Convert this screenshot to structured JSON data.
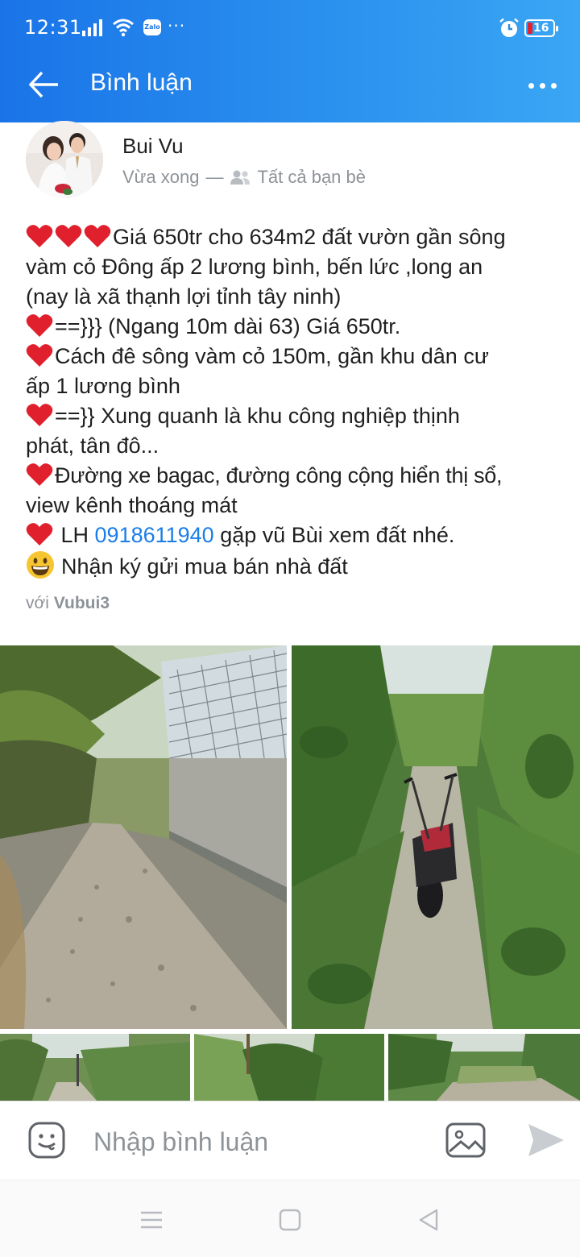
{
  "status_bar": {
    "time": "12:31",
    "app_badge": "Zalo",
    "more": "···",
    "battery_level": "16"
  },
  "header": {
    "title": "Bình luận"
  },
  "post": {
    "author": "Bui Vu",
    "time": "Vừa xong",
    "separator": "—",
    "privacy": "Tất cả bạn bè",
    "lines": {
      "l1": "Giá 650tr cho 634m2 đất vườn gần sông",
      "l2": "vàm cỏ Đông ấp 2 lương bình, bến lức ,long an",
      "l3": "(nay là xã thạnh lợi tỉnh tây ninh)",
      "l4": "==}}} (Ngang 10m dài 63) Giá 650tr.",
      "l5": "Cách đê sông vàm cỏ 150m, gần khu dân cư",
      "l6": "ấp 1 lương bình",
      "l7": "==}} Xung quanh là khu công nghiệp thịnh",
      "l8": "phát, tân đô...",
      "l9": "Đường xe bagac, đường công cộng hiển thị sổ,",
      "l10": "view kênh thoáng mát",
      "l11_pre": " LH ",
      "l11_phone": "0918611940",
      "l11_post": " gặp vũ Bùi xem đất nhé.",
      "l12": "Nhận ký gửi mua bán nhà đất"
    },
    "with_label": "với",
    "tagged_user": "Vubui3"
  },
  "photos": [
    {
      "subject": "gravel-path-beside-fence"
    },
    {
      "subject": "motorbike-on-dirt-path"
    },
    {
      "subject": "coconut-trees"
    },
    {
      "subject": "palm-and-shrubs"
    },
    {
      "subject": "dirt-road-field"
    }
  ],
  "comment_bar": {
    "placeholder": "Nhập bình luận"
  },
  "colors": {
    "header_gradient_start": "#1a74e8",
    "header_gradient_end": "#3aa6f4",
    "link": "#1a7ee8",
    "heart": "#e0202c",
    "muted_text": "#8e9398"
  }
}
